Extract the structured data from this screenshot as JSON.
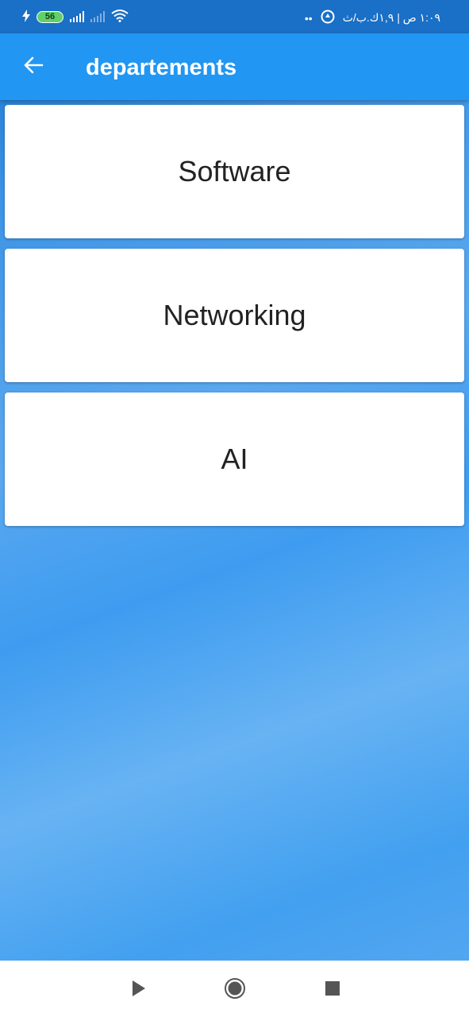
{
  "status_bar": {
    "battery_level": "56",
    "clock_text": "١:٠٩ ص | ١,٩ك.ب/ث",
    "dots": "••",
    "icons": [
      "charging-icon",
      "battery-icon",
      "signal-icon",
      "signal-weak-icon",
      "wifi-icon",
      "vpn-icon"
    ]
  },
  "app_bar": {
    "title": "departements",
    "back_icon": "arrow-left-icon",
    "color": "#2196f3"
  },
  "departments": [
    {
      "label": "Software"
    },
    {
      "label": "Networking"
    },
    {
      "label": "AI"
    }
  ],
  "nav_bar": {
    "icons": [
      "back-triangle-icon",
      "home-circle-icon",
      "recents-square-icon"
    ]
  }
}
